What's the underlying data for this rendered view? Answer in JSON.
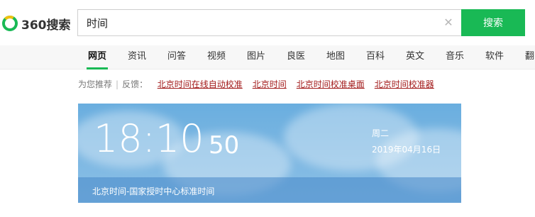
{
  "header": {
    "logo_text": "360搜索",
    "search_value": "时间",
    "search_button": "搜索"
  },
  "tabs": [
    {
      "label": "网页",
      "active": true
    },
    {
      "label": "资讯"
    },
    {
      "label": "问答"
    },
    {
      "label": "视频"
    },
    {
      "label": "图片"
    },
    {
      "label": "良医"
    },
    {
      "label": "地图"
    },
    {
      "label": "百科"
    },
    {
      "label": "英文"
    },
    {
      "label": "音乐"
    },
    {
      "label": "软件"
    },
    {
      "label": "翻"
    }
  ],
  "recommend": {
    "prefix": "为您推荐",
    "feedback": "反馈：",
    "links": [
      "北京时间在线自动校准",
      "北京时间",
      "北京时间校准桌面",
      "北京时间校准器"
    ]
  },
  "time_card": {
    "hour_min": "18:10",
    "seconds": "50",
    "weekday": "周二",
    "date": "2019年04月16日",
    "footer": "北京时间-国家授时中心标准时间"
  }
}
